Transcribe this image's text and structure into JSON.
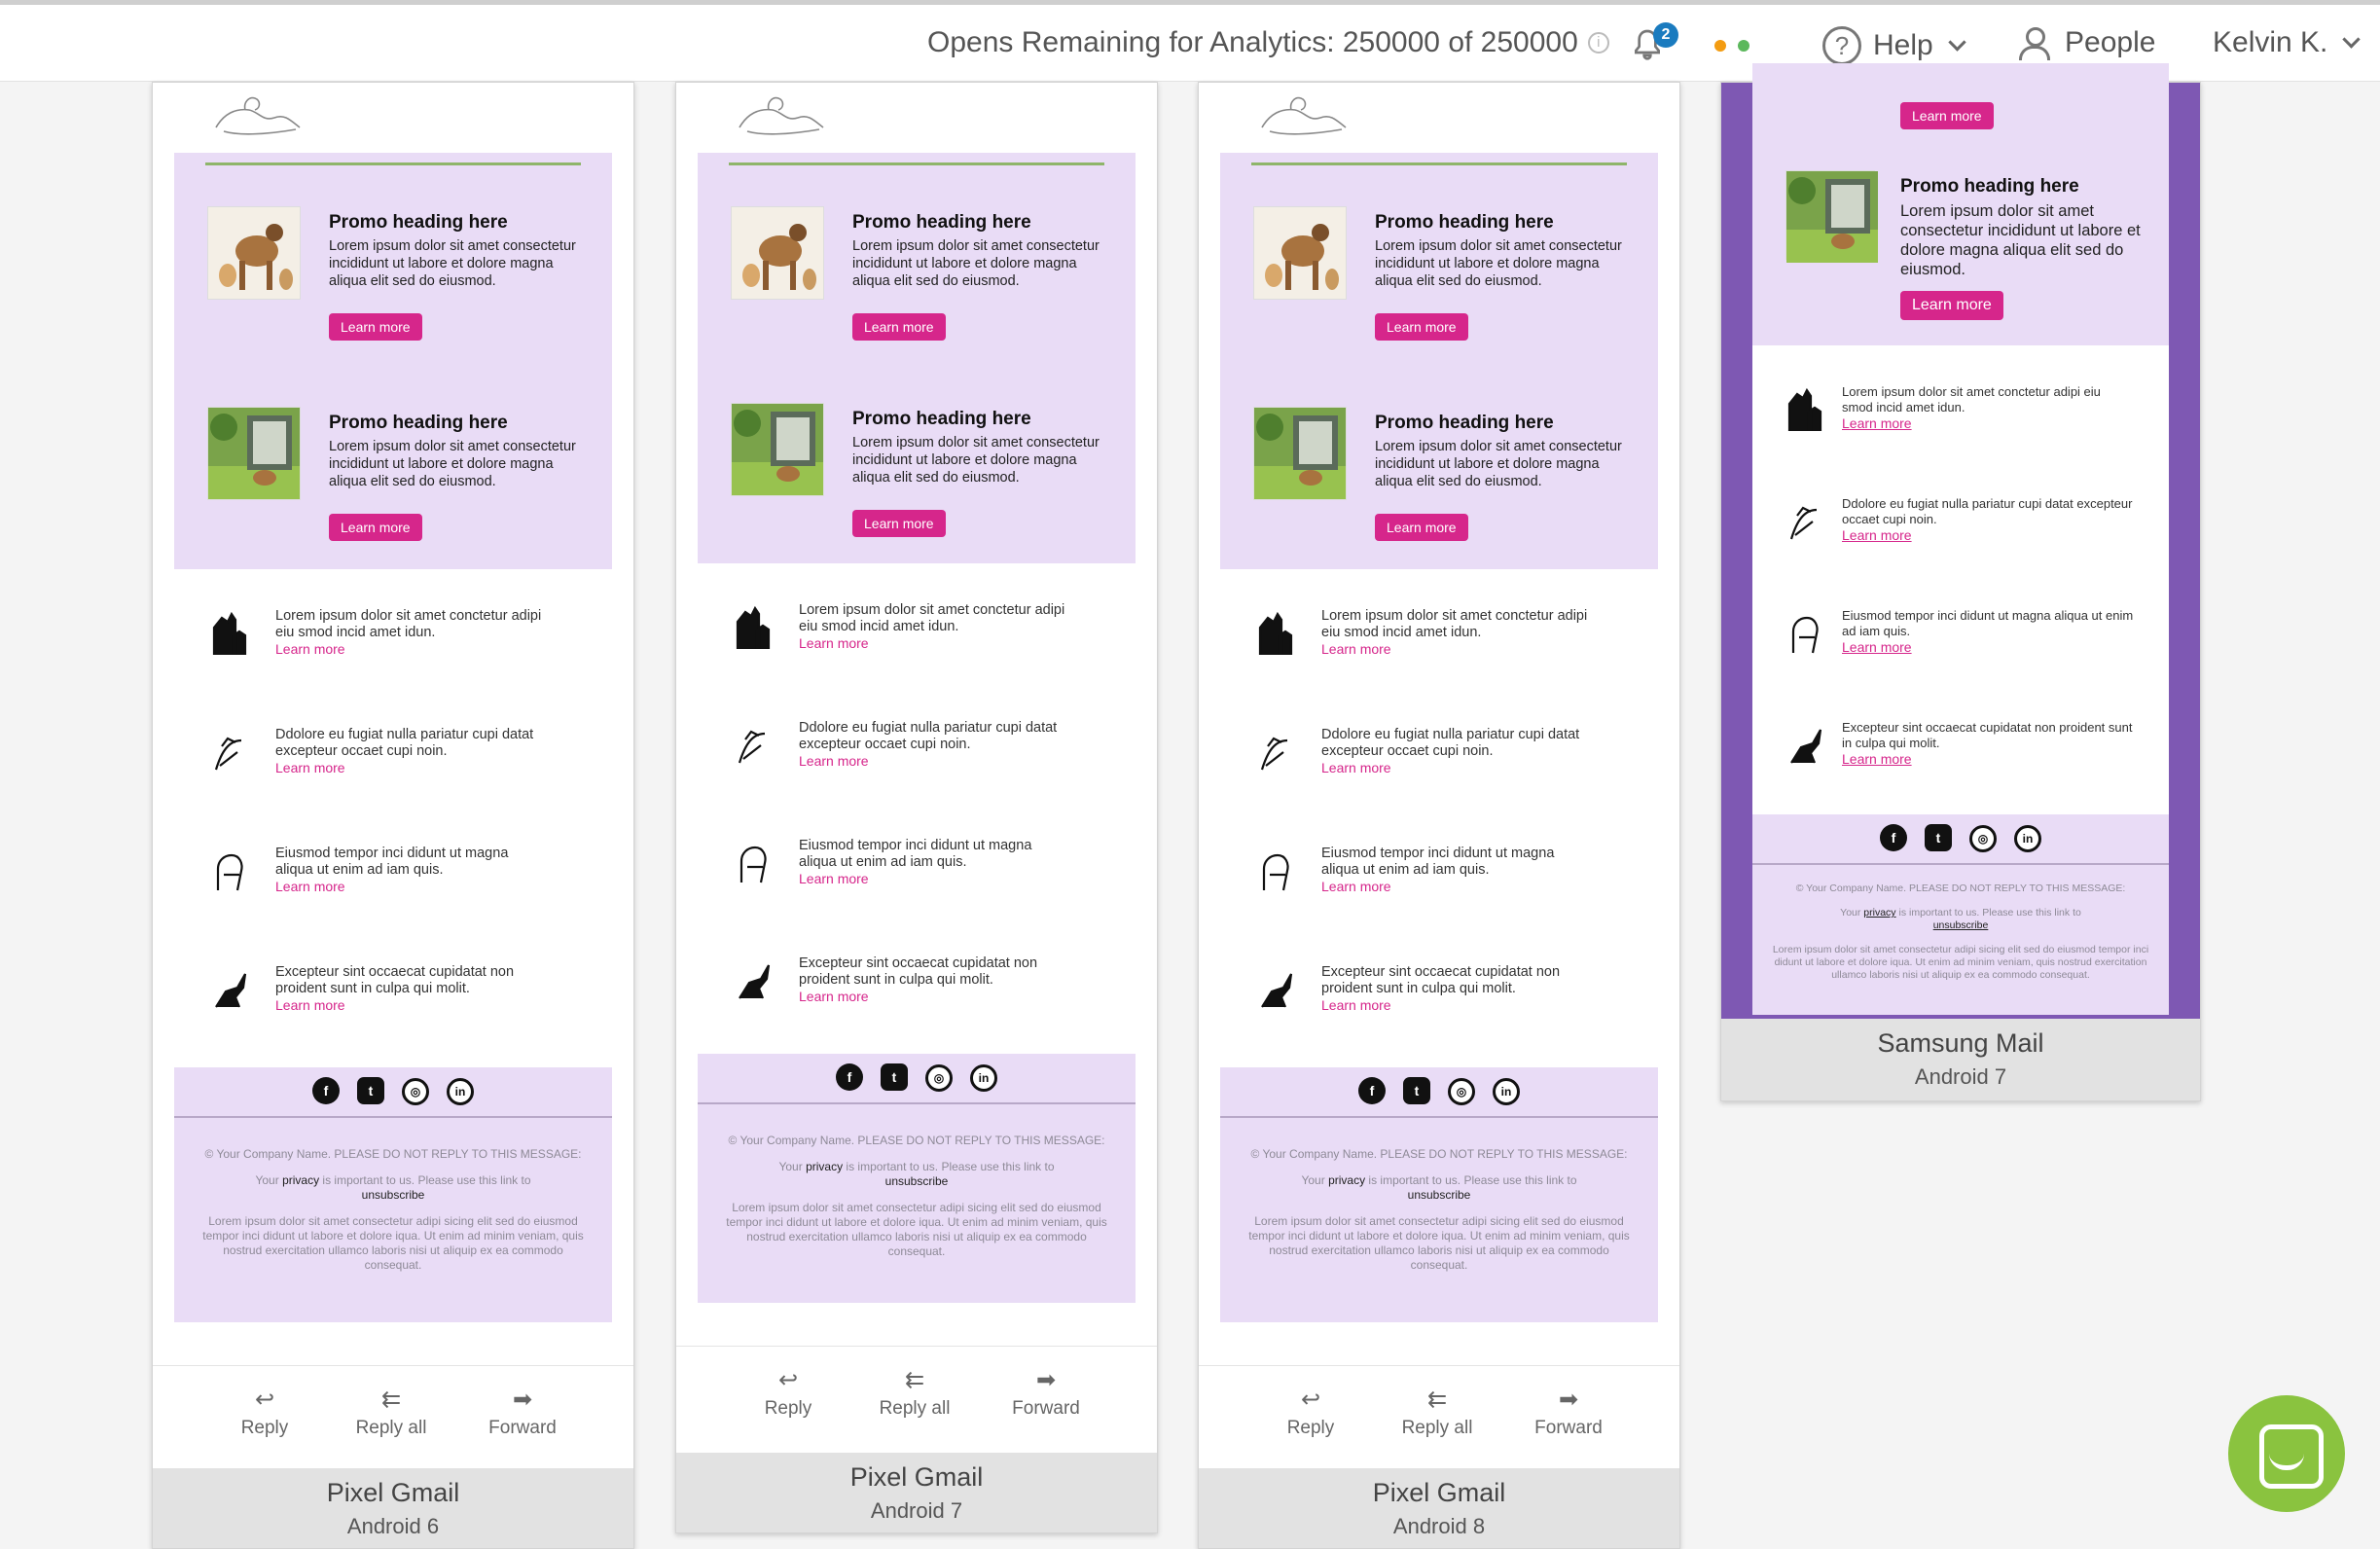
{
  "topbar": {
    "opens_text": "Opens Remaining for Analytics: 250000 of 250000",
    "notification_count": "2",
    "status_dot_colors": [
      "#f39c12",
      "#5cb85c"
    ],
    "help_label": "Help",
    "people_label": "People",
    "user_label": "Kelvin K."
  },
  "email": {
    "promo_heading": "Promo heading here",
    "promo_text": "Lorem ipsum dolor sit amet consectetur incididunt ut labore et dolore magna aliqua elit sed do eiusmod.",
    "learn_more_button": "Learn more",
    "list_items": [
      {
        "text": "Lorem ipsum dolor sit amet conctetur adipi eiu smod incid amet idun.",
        "link": "Learn more",
        "icon": "horse-rider-icon"
      },
      {
        "text": "Ddolore eu fugiat nulla pariatur cupi datat excepteur occaet cupi noin.",
        "link": "Learn more",
        "icon": "dog-sketch-icon"
      },
      {
        "text": "Eiusmod tempor inci didunt ut magna aliqua ut enim ad iam quis.",
        "link": "Learn more",
        "icon": "dog-sitting-icon"
      },
      {
        "text": "Excepteur sint occaecat cupidatat non proident sunt in culpa qui molit.",
        "link": "Learn more",
        "icon": "cat-silhouette-icon"
      }
    ],
    "social_icons": [
      "facebook-icon",
      "twitter-icon",
      "instagram-icon",
      "linkedin-icon"
    ],
    "footer_company": "© Your Company Name. PLEASE DO NOT REPLY TO THIS MESSAGE:",
    "footer_privacy_pre": "Your",
    "footer_privacy_link": "privacy",
    "footer_privacy_post": "is important to us. Please use this link to",
    "footer_unsubscribe": "unsubscribe",
    "footer_lorem": "Lorem ipsum dolor sit amet consectetur adipi sicing elit sed do eiusmod tempor inci didunt ut labore et dolore iqua. Ut enim ad minim veniam, quis nostrud exercitation ullamco laboris nisi ut aliquip ex ea commodo consequat."
  },
  "actions": {
    "reply": "Reply",
    "reply_all": "Reply all",
    "forward": "Forward"
  },
  "devices": [
    {
      "name": "Pixel Gmail",
      "version": "Android 6"
    },
    {
      "name": "Pixel Gmail",
      "version": "Android 7"
    },
    {
      "name": "Pixel Gmail",
      "version": "Android 8"
    },
    {
      "name": "Samsung Mail",
      "version": "Android 7"
    }
  ]
}
